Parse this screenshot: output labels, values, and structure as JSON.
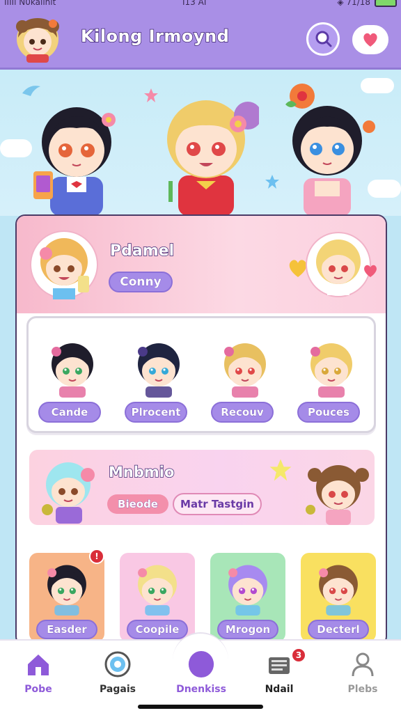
{
  "status_bar": {
    "carrier": "IIIIl N0kaiinit",
    "time": "I13 AI",
    "right": "◈ 71/18"
  },
  "header": {
    "title": "Kilong Irmoynd"
  },
  "profile": {
    "name": "Pdamel",
    "tag": "Conny"
  },
  "friends": [
    {
      "label": "Cande",
      "hair": "#1f1d2b",
      "accent": "#e46b9e",
      "eye": "#3aa760"
    },
    {
      "label": "Plrocent",
      "hair": "#1f2440",
      "accent": "#4a3a88",
      "eye": "#35a9d8"
    },
    {
      "label": "Recouv",
      "hair": "#e8c060",
      "accent": "#e46b9e",
      "eye": "#e04848"
    },
    {
      "label": "Pouces",
      "hair": "#f0cc6a",
      "accent": "#e46b9e",
      "eye": "#d9a83a"
    }
  ],
  "banner": {
    "title": "Mnbmio",
    "tag1": "Bieode",
    "tag2": "Matr Tastgin"
  },
  "grid": [
    {
      "label": "Easder",
      "bg": "#f7b487",
      "hair": "#1f1d2b",
      "eye": "#3aa760",
      "badge": "!"
    },
    {
      "label": "Coopile",
      "bg": "#f9c8e4",
      "hair": "#f3e08a",
      "eye": "#3aa760"
    },
    {
      "label": "Mrogon",
      "bg": "#a8e6b8",
      "hair": "#a78af0",
      "eye": "#b24ad0"
    },
    {
      "label": "Decterl",
      "bg": "#f9e060",
      "hair": "#8a5a34",
      "eye": "#d94848"
    }
  ],
  "nav": [
    {
      "label": "Pobe",
      "icon": "home-icon",
      "color": "#8e5ad9"
    },
    {
      "label": "Pagais",
      "icon": "camera-lens-icon",
      "color": "#333333"
    },
    {
      "label": "Dnenkiss",
      "icon": "center-orb-icon",
      "color": "#8e5ad9"
    },
    {
      "label": "Ndail",
      "icon": "mail-icon",
      "color": "#222222",
      "badge": "3"
    },
    {
      "label": "Plebs",
      "icon": "profile-icon",
      "color": "#999999"
    }
  ],
  "colors": {
    "header": "#a98fe6",
    "accent": "#a58be8",
    "pink": "#f7b9cc"
  }
}
